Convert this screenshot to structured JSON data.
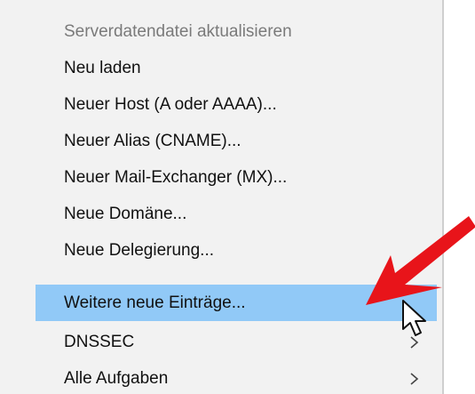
{
  "context_menu": {
    "items": [
      {
        "label": "Serverdatendatei aktualisieren",
        "state": "disabled"
      },
      {
        "label": "Neu laden",
        "state": "normal"
      },
      {
        "label": "Neuer Host (A oder AAAA)...",
        "state": "normal"
      },
      {
        "label": "Neuer Alias (CNAME)...",
        "state": "normal"
      },
      {
        "label": "Neuer Mail-Exchanger (MX)...",
        "state": "normal"
      },
      {
        "label": "Neue Domäne...",
        "state": "normal"
      },
      {
        "label": "Neue Delegierung...",
        "state": "normal"
      },
      {
        "label": "Weitere neue Einträge...",
        "state": "highlighted"
      },
      {
        "label": "DNSSEC",
        "state": "normal",
        "has_submenu": true
      },
      {
        "label": "Alle Aufgaben",
        "state": "normal",
        "has_submenu": true
      }
    ]
  },
  "colors": {
    "menu_background": "#f2f2f2",
    "highlight": "#91c9f7",
    "disabled_text": "#7a7a7a",
    "annotation_arrow": "#e8141a"
  },
  "icons": {
    "submenu": "chevron-right-icon",
    "pointer": "mouse-cursor-icon",
    "annotation": "red-arrow-icon"
  }
}
